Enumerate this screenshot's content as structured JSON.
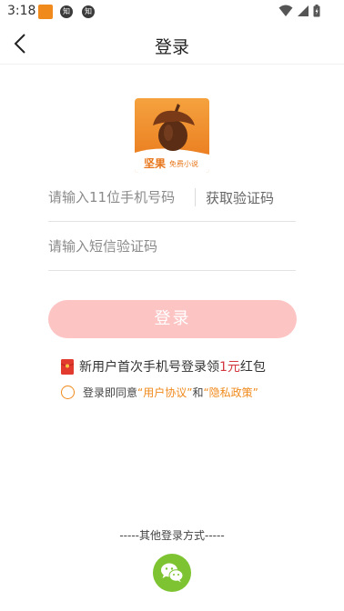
{
  "status_bar": {
    "time": "3:18",
    "notif_1": "知",
    "notif_2": "知"
  },
  "nav": {
    "title": "登录"
  },
  "logo": {
    "brand_text": "坚果",
    "sub_text": "免费小说"
  },
  "form": {
    "phone_placeholder": "请输入11位手机号码",
    "get_code_label": "获取验证码",
    "sms_placeholder": "请输入短信验证码",
    "login_label": "登录"
  },
  "promo": {
    "text_before": "新用户首次手机号登录领",
    "amount": "1元",
    "text_after": "红包"
  },
  "agreement": {
    "prefix": "登录即同意",
    "user_agreement": "“用户协议”",
    "and": "和",
    "privacy_policy": "“隐私政策”"
  },
  "other_login": {
    "label": "-----其他登录方式-----"
  },
  "colors": {
    "accent": "#f08a1c",
    "login_button": "#fdc4c4",
    "amount": "#d2373f",
    "wechat": "#7ec432"
  }
}
